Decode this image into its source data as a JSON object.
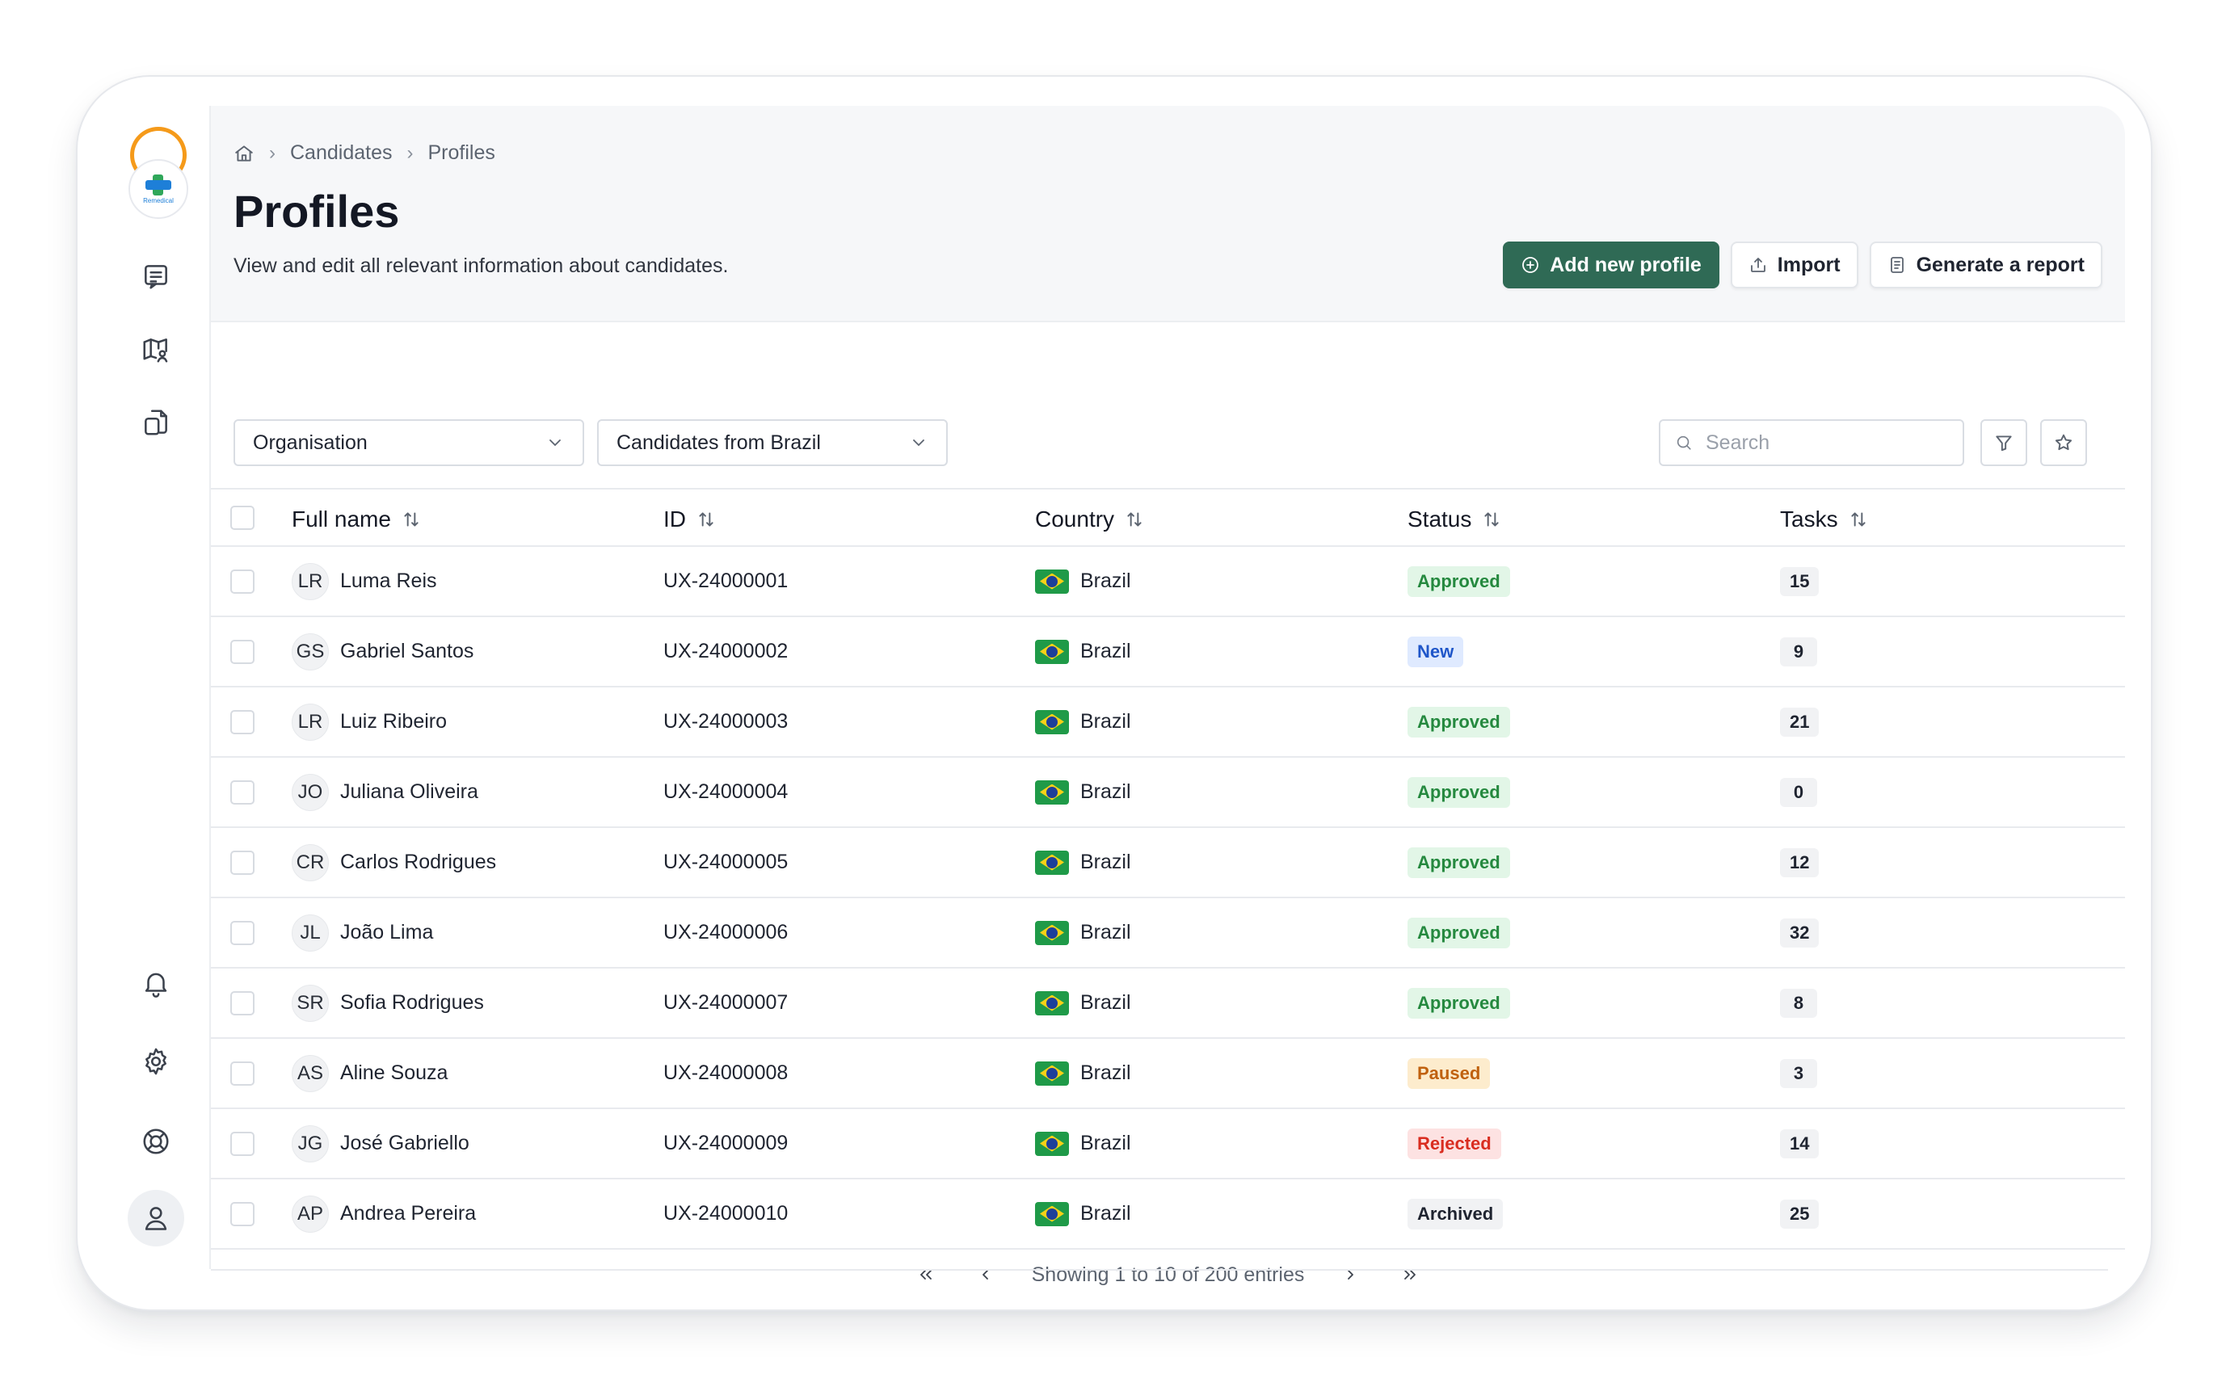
{
  "brand": {
    "logo_text": "Remedical"
  },
  "breadcrumb": [
    "Candidates",
    "Profiles"
  ],
  "page": {
    "title": "Profiles",
    "subtitle": "View and edit all relevant information about candidates."
  },
  "actions": {
    "add_label": "Add new profile",
    "import_label": "Import",
    "report_label": "Generate a report"
  },
  "filters": {
    "organisation": "Organisation",
    "candidates": "Candidates from Brazil",
    "search_placeholder": "Search"
  },
  "table": {
    "columns": [
      "Full name",
      "ID",
      "Country",
      "Status",
      "Tasks"
    ],
    "rows": [
      {
        "initials": "LR",
        "name": "Luma Reis",
        "id": "UX-24000001",
        "country": "Brazil",
        "status": "Approved",
        "tasks": "15"
      },
      {
        "initials": "GS",
        "name": "Gabriel Santos",
        "id": "UX-24000002",
        "country": "Brazil",
        "status": "New",
        "tasks": "9"
      },
      {
        "initials": "LR",
        "name": "Luiz Ribeiro",
        "id": "UX-24000003",
        "country": "Brazil",
        "status": "Approved",
        "tasks": "21"
      },
      {
        "initials": "JO",
        "name": "Juliana Oliveira",
        "id": "UX-24000004",
        "country": "Brazil",
        "status": "Approved",
        "tasks": "0"
      },
      {
        "initials": "CR",
        "name": "Carlos Rodrigues",
        "id": "UX-24000005",
        "country": "Brazil",
        "status": "Approved",
        "tasks": "12"
      },
      {
        "initials": "JL",
        "name": "João Lima",
        "id": "UX-24000006",
        "country": "Brazil",
        "status": "Approved",
        "tasks": "32"
      },
      {
        "initials": "SR",
        "name": "Sofia Rodrigues",
        "id": "UX-24000007",
        "country": "Brazil",
        "status": "Approved",
        "tasks": "8"
      },
      {
        "initials": "AS",
        "name": "Aline Souza",
        "id": "UX-24000008",
        "country": "Brazil",
        "status": "Paused",
        "tasks": "3"
      },
      {
        "initials": "JG",
        "name": "José Gabriello",
        "id": "UX-24000009",
        "country": "Brazil",
        "status": "Rejected",
        "tasks": "14"
      },
      {
        "initials": "AP",
        "name": "Andrea Pereira",
        "id": "UX-24000010",
        "country": "Brazil",
        "status": "Archived",
        "tasks": "25"
      }
    ]
  },
  "pagination": {
    "text": "Showing 1 to 10 of 200 entries"
  },
  "colors": {
    "primary": "#2f6a55",
    "approved": "#25893f",
    "new": "#1f56c9",
    "paused": "#c0610f",
    "rejected": "#d92d20",
    "logo_orange": "#f59a1a"
  },
  "icons": {
    "sidebar": [
      "notes-icon",
      "map-user-icon",
      "documents-icon",
      "bell-icon",
      "gear-icon",
      "lifebuoy-icon",
      "user-icon"
    ]
  }
}
